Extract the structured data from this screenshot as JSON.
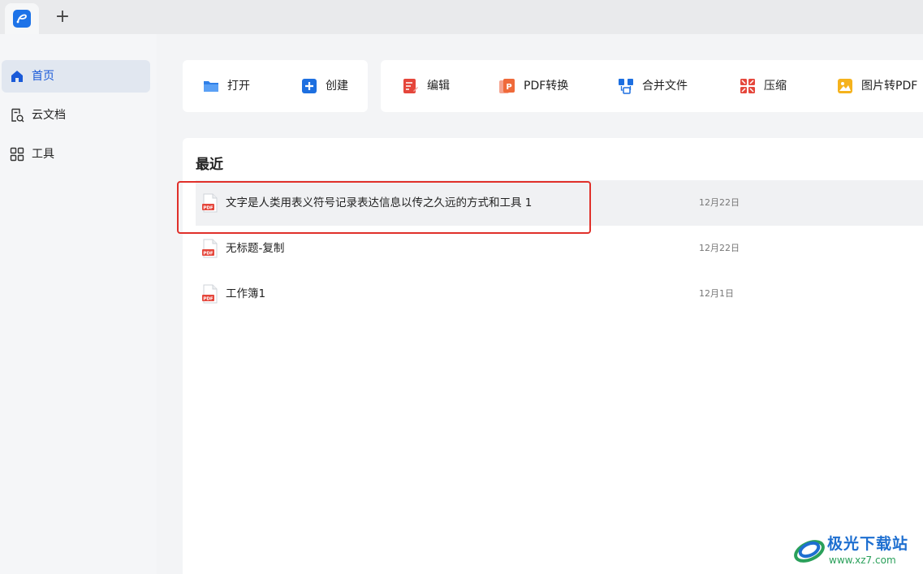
{
  "tabbar": {
    "add_tab_label": "+"
  },
  "sidebar": {
    "items": [
      {
        "label": "首页",
        "icon": "home-icon",
        "active": true
      },
      {
        "label": "云文档",
        "icon": "cloud-doc-icon",
        "active": false
      },
      {
        "label": "工具",
        "icon": "tools-grid-icon",
        "active": false
      }
    ]
  },
  "toolbar": {
    "open_label": "打开",
    "create_label": "创建",
    "edit_label": "编辑",
    "pdf_convert_label": "PDF转换",
    "merge_label": "合并文件",
    "compress_label": "压缩",
    "image_to_pdf_label": "图片转PDF"
  },
  "recent": {
    "title": "最近",
    "files": [
      {
        "name": "文字是人类用表义符号记录表达信息以传之久远的方式和工具 1",
        "date": "12月22日",
        "icon": "pdf-file-icon"
      },
      {
        "name": "无标题-复制",
        "date": "12月22日",
        "icon": "pdf-file-icon"
      },
      {
        "name": "工作簿1",
        "date": "12月1日",
        "icon": "pdf-file-icon"
      }
    ]
  },
  "watermark": {
    "name": "极光下载站",
    "url": "www.xz7.com"
  },
  "colors": {
    "accent": "#1a5ad8",
    "highlight": "#e0302a",
    "pdf_red": "#e5463b"
  }
}
